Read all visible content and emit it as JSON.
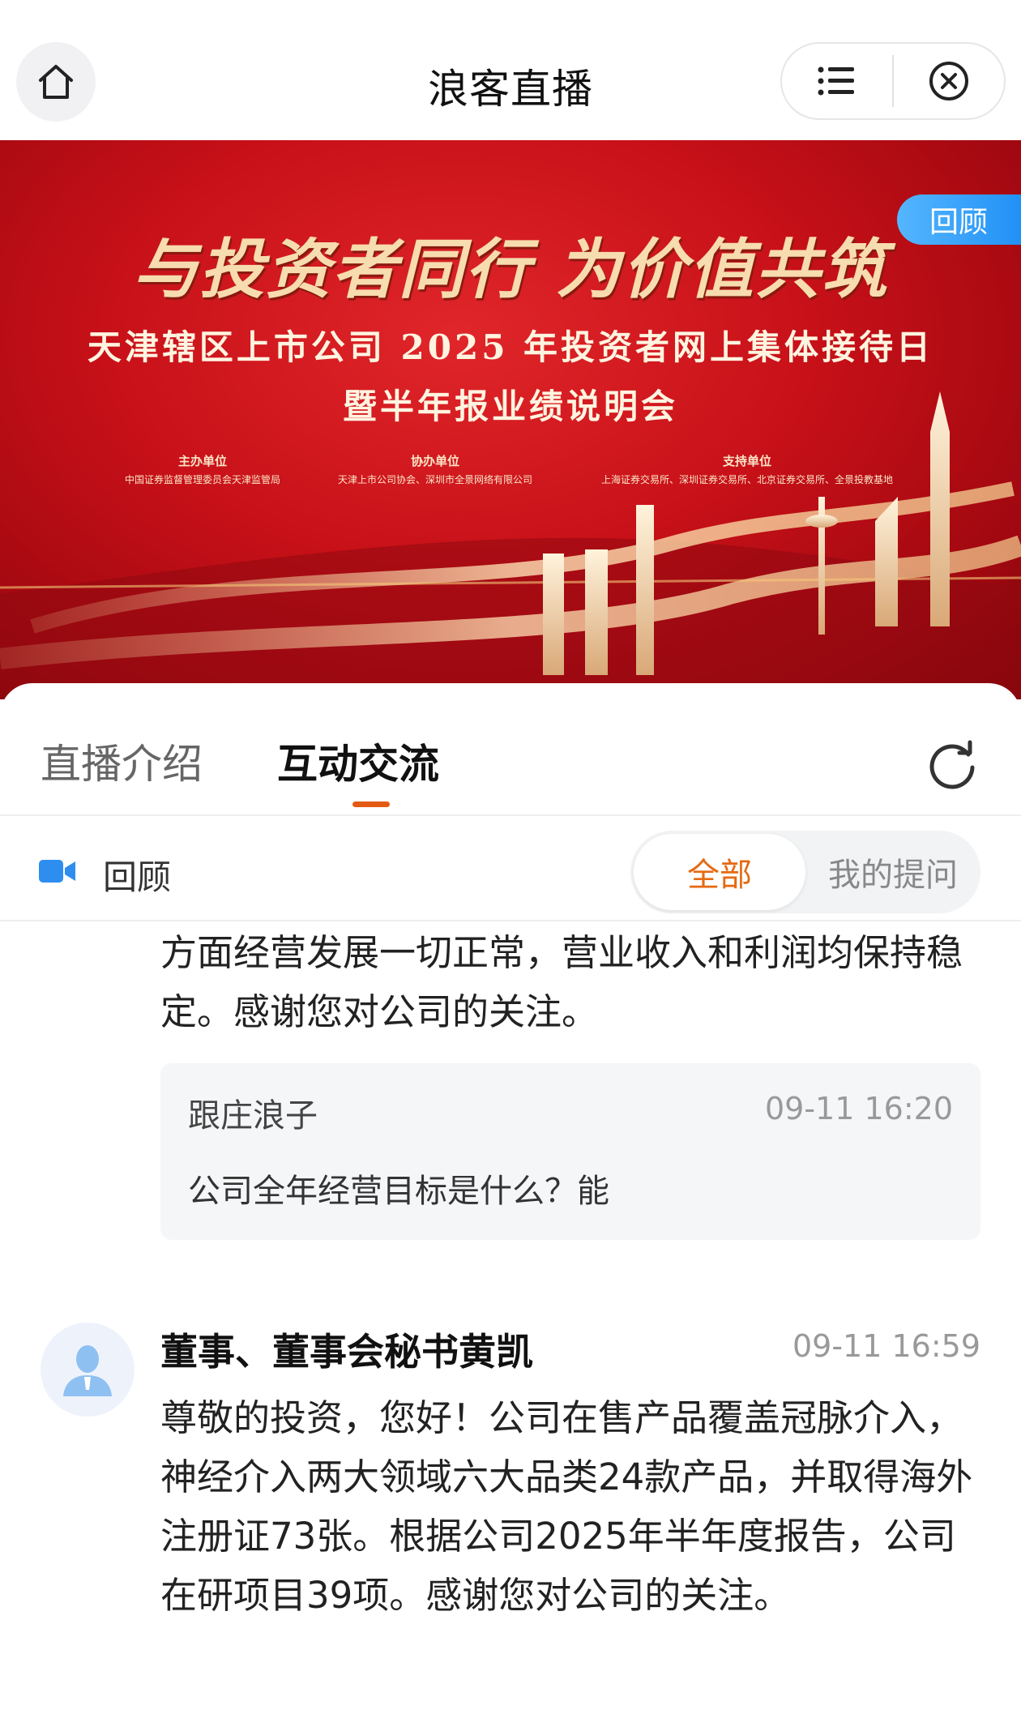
{
  "nav": {
    "title": "浪客直播"
  },
  "banner": {
    "slogan": "与投资者同行 为价值共筑",
    "title_line1": "天津辖区上市公司 2025 年投资者网上集体接待日",
    "title_line2": "暨半年报业绩说明会",
    "organizers": [
      {
        "role": "主办单位",
        "names": "中国证券监督管理委员会天津监管局"
      },
      {
        "role": "协办单位",
        "names": "天津上市公司协会、深圳市全景网络有限公司"
      },
      {
        "role": "支持单位",
        "names": "上海证券交易所、深圳证券交易所、北京证券交易所、全景投教基地"
      }
    ],
    "badge": "回顾"
  },
  "tabs": {
    "intro": "直播介绍",
    "interact": "互动交流"
  },
  "filter": {
    "label": "回顾",
    "all": "全部",
    "mine": "我的提问"
  },
  "feed": {
    "prev_answer_tail": "方面经营发展一切正常，营业收入和利润均保持稳定。感谢您对公司的关注。",
    "question": {
      "user": "跟庄浪子",
      "time": "09-11 16:20",
      "text": "公司全年经营目标是什么？能"
    },
    "reply": {
      "author": "董事、董事会秘书黄凯",
      "time": "09-11 16:59",
      "text": "尊敬的投资，您好！公司在售产品覆盖冠脉介入，神经介入两大领域六大品类24款产品，并取得海外注册证73张。根据公司2025年半年度报告，公司在研项目39项。感谢您对公司的关注。"
    }
  },
  "icons": {
    "home": "home-icon",
    "menu": "menu-icon",
    "close": "close-circle-icon",
    "refresh": "refresh-icon",
    "video": "video-camera-icon",
    "avatar": "user-avatar-icon"
  },
  "colors": {
    "accent_orange": "#e56a12",
    "badge_blue": "#2b95f5",
    "banner_red": "#c71018"
  }
}
